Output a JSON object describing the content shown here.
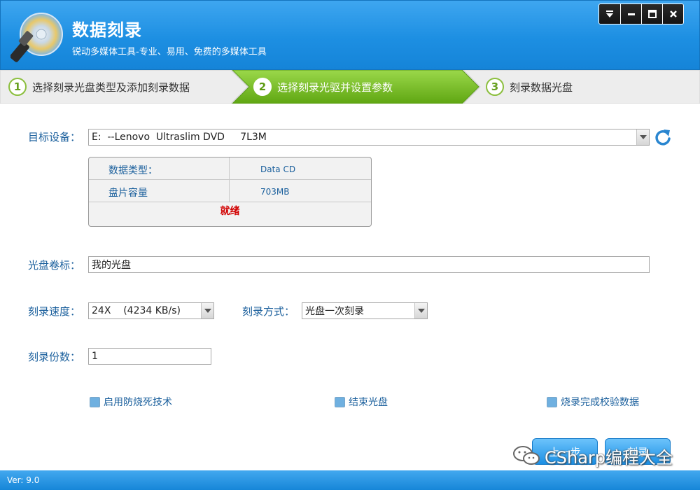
{
  "header": {
    "title": "数据刻录",
    "subtitle": "锐动多媒体工具-专业、易用、免费的多媒体工具",
    "controls": [
      "menu-icon",
      "minimize-icon",
      "maximize-icon",
      "close-icon"
    ]
  },
  "steps": [
    {
      "num": "1",
      "label": "选择刻录光盘类型及添加刻录数据",
      "active": false
    },
    {
      "num": "2",
      "label": "选择刻录光驱并设置参数",
      "active": true
    },
    {
      "num": "3",
      "label": "刻录数据光盘",
      "active": false
    }
  ],
  "form": {
    "device_label": "目标设备：",
    "device_value": "E:  --Lenovo  Ultraslim DVD     7L3M",
    "info": {
      "type_key": "数据类型：",
      "type_val": "Data CD",
      "capacity_key": "盘片容量",
      "capacity_val": "703MB",
      "status": "就绪"
    },
    "volume_label": "光盘卷标：",
    "volume_value": "我的光盘",
    "speed_label": "刻录速度：",
    "speed_value": "24X    (4234 KB/s)",
    "mode_label": "刻录方式：",
    "mode_value": "光盘一次刻录",
    "copies_label": "刻录份数：",
    "copies_value": "1",
    "checkboxes": [
      "启用防烧死技术",
      "结束光盘",
      "烧录完成校验数据"
    ]
  },
  "buttons": {
    "prev": "上一步",
    "next": "刻录"
  },
  "watermark": "CSharp编程大全",
  "footer": {
    "version": "Ver: 9.0"
  },
  "colors": {
    "header_blue": "#1d8fe2",
    "active_step_green": "#7cc31e",
    "label_blue": "#1a5f9c",
    "status_red": "#d10000"
  }
}
